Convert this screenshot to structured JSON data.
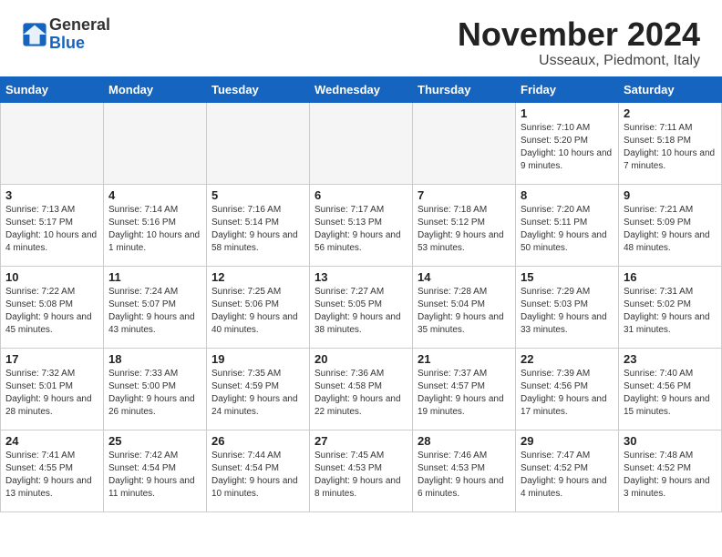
{
  "header": {
    "logo_general": "General",
    "logo_blue": "Blue",
    "month_title": "November 2024",
    "location": "Usseaux, Piedmont, Italy"
  },
  "calendar": {
    "weekdays": [
      "Sunday",
      "Monday",
      "Tuesday",
      "Wednesday",
      "Thursday",
      "Friday",
      "Saturday"
    ],
    "weeks": [
      [
        {
          "day": "",
          "info": "",
          "empty": true
        },
        {
          "day": "",
          "info": "",
          "empty": true
        },
        {
          "day": "",
          "info": "",
          "empty": true
        },
        {
          "day": "",
          "info": "",
          "empty": true
        },
        {
          "day": "",
          "info": "",
          "empty": true
        },
        {
          "day": "1",
          "info": "Sunrise: 7:10 AM\nSunset: 5:20 PM\nDaylight: 10 hours and 9 minutes.",
          "empty": false
        },
        {
          "day": "2",
          "info": "Sunrise: 7:11 AM\nSunset: 5:18 PM\nDaylight: 10 hours and 7 minutes.",
          "empty": false
        }
      ],
      [
        {
          "day": "3",
          "info": "Sunrise: 7:13 AM\nSunset: 5:17 PM\nDaylight: 10 hours and 4 minutes.",
          "empty": false
        },
        {
          "day": "4",
          "info": "Sunrise: 7:14 AM\nSunset: 5:16 PM\nDaylight: 10 hours and 1 minute.",
          "empty": false
        },
        {
          "day": "5",
          "info": "Sunrise: 7:16 AM\nSunset: 5:14 PM\nDaylight: 9 hours and 58 minutes.",
          "empty": false
        },
        {
          "day": "6",
          "info": "Sunrise: 7:17 AM\nSunset: 5:13 PM\nDaylight: 9 hours and 56 minutes.",
          "empty": false
        },
        {
          "day": "7",
          "info": "Sunrise: 7:18 AM\nSunset: 5:12 PM\nDaylight: 9 hours and 53 minutes.",
          "empty": false
        },
        {
          "day": "8",
          "info": "Sunrise: 7:20 AM\nSunset: 5:11 PM\nDaylight: 9 hours and 50 minutes.",
          "empty": false
        },
        {
          "day": "9",
          "info": "Sunrise: 7:21 AM\nSunset: 5:09 PM\nDaylight: 9 hours and 48 minutes.",
          "empty": false
        }
      ],
      [
        {
          "day": "10",
          "info": "Sunrise: 7:22 AM\nSunset: 5:08 PM\nDaylight: 9 hours and 45 minutes.",
          "empty": false
        },
        {
          "day": "11",
          "info": "Sunrise: 7:24 AM\nSunset: 5:07 PM\nDaylight: 9 hours and 43 minutes.",
          "empty": false
        },
        {
          "day": "12",
          "info": "Sunrise: 7:25 AM\nSunset: 5:06 PM\nDaylight: 9 hours and 40 minutes.",
          "empty": false
        },
        {
          "day": "13",
          "info": "Sunrise: 7:27 AM\nSunset: 5:05 PM\nDaylight: 9 hours and 38 minutes.",
          "empty": false
        },
        {
          "day": "14",
          "info": "Sunrise: 7:28 AM\nSunset: 5:04 PM\nDaylight: 9 hours and 35 minutes.",
          "empty": false
        },
        {
          "day": "15",
          "info": "Sunrise: 7:29 AM\nSunset: 5:03 PM\nDaylight: 9 hours and 33 minutes.",
          "empty": false
        },
        {
          "day": "16",
          "info": "Sunrise: 7:31 AM\nSunset: 5:02 PM\nDaylight: 9 hours and 31 minutes.",
          "empty": false
        }
      ],
      [
        {
          "day": "17",
          "info": "Sunrise: 7:32 AM\nSunset: 5:01 PM\nDaylight: 9 hours and 28 minutes.",
          "empty": false
        },
        {
          "day": "18",
          "info": "Sunrise: 7:33 AM\nSunset: 5:00 PM\nDaylight: 9 hours and 26 minutes.",
          "empty": false
        },
        {
          "day": "19",
          "info": "Sunrise: 7:35 AM\nSunset: 4:59 PM\nDaylight: 9 hours and 24 minutes.",
          "empty": false
        },
        {
          "day": "20",
          "info": "Sunrise: 7:36 AM\nSunset: 4:58 PM\nDaylight: 9 hours and 22 minutes.",
          "empty": false
        },
        {
          "day": "21",
          "info": "Sunrise: 7:37 AM\nSunset: 4:57 PM\nDaylight: 9 hours and 19 minutes.",
          "empty": false
        },
        {
          "day": "22",
          "info": "Sunrise: 7:39 AM\nSunset: 4:56 PM\nDaylight: 9 hours and 17 minutes.",
          "empty": false
        },
        {
          "day": "23",
          "info": "Sunrise: 7:40 AM\nSunset: 4:56 PM\nDaylight: 9 hours and 15 minutes.",
          "empty": false
        }
      ],
      [
        {
          "day": "24",
          "info": "Sunrise: 7:41 AM\nSunset: 4:55 PM\nDaylight: 9 hours and 13 minutes.",
          "empty": false
        },
        {
          "day": "25",
          "info": "Sunrise: 7:42 AM\nSunset: 4:54 PM\nDaylight: 9 hours and 11 minutes.",
          "empty": false
        },
        {
          "day": "26",
          "info": "Sunrise: 7:44 AM\nSunset: 4:54 PM\nDaylight: 9 hours and 10 minutes.",
          "empty": false
        },
        {
          "day": "27",
          "info": "Sunrise: 7:45 AM\nSunset: 4:53 PM\nDaylight: 9 hours and 8 minutes.",
          "empty": false
        },
        {
          "day": "28",
          "info": "Sunrise: 7:46 AM\nSunset: 4:53 PM\nDaylight: 9 hours and 6 minutes.",
          "empty": false
        },
        {
          "day": "29",
          "info": "Sunrise: 7:47 AM\nSunset: 4:52 PM\nDaylight: 9 hours and 4 minutes.",
          "empty": false
        },
        {
          "day": "30",
          "info": "Sunrise: 7:48 AM\nSunset: 4:52 PM\nDaylight: 9 hours and 3 minutes.",
          "empty": false
        }
      ]
    ]
  }
}
